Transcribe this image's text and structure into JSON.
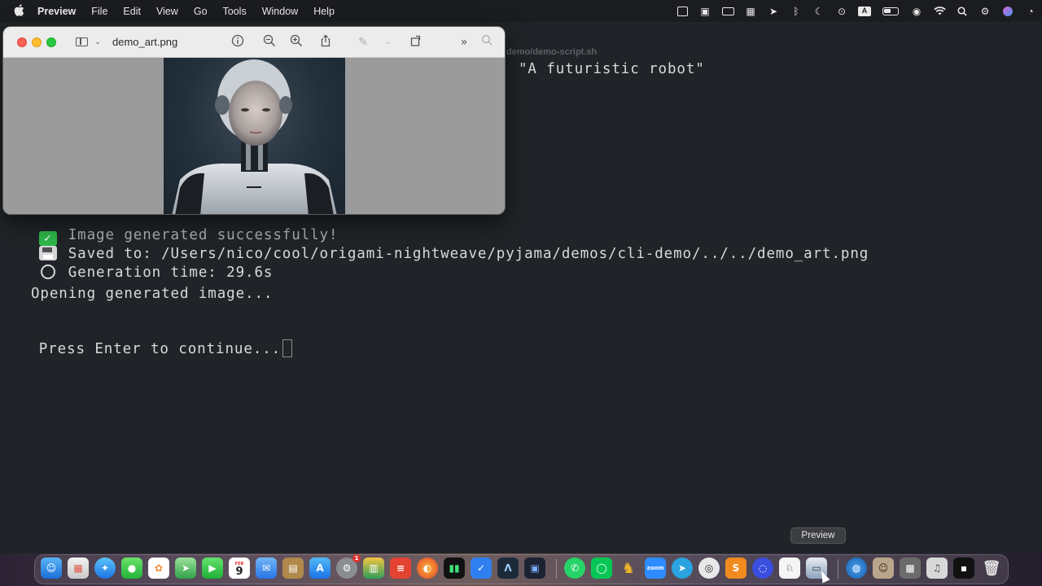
{
  "menubar": {
    "app_name": "Preview",
    "menus": [
      "File",
      "Edit",
      "View",
      "Go",
      "Tools",
      "Window",
      "Help"
    ],
    "status_icons": [
      "display-icon",
      "calendar-icon",
      "monitor-icon",
      "keyboard-icon",
      "telegram-icon",
      "bluetooth-icon",
      "moon-icon",
      "play-icon",
      "input-source-icon",
      "battery-icon",
      "user-icon",
      "wifi-icon",
      "search-icon",
      "control-center-icon",
      "siri-icon",
      "clock-icon"
    ],
    "input_source_label": "A"
  },
  "terminal": {
    "title_fragment": "demo/demo-script.sh",
    "prompt_fragment": "\"A futuristic robot\"",
    "lines": {
      "success": "Image generated successfully!",
      "saved": "Saved to: /Users/nico/cool/origami-nightweave/pyjama/demos/cli-demo/../../demo_art.png",
      "time": "Generation time: 29.6s",
      "opening": "Opening generated image...",
      "press": "Press Enter to continue..."
    }
  },
  "preview_window": {
    "filename": "demo_art.png",
    "toolbar_icons": [
      "sidebar-toggle-icon",
      "chevron-down-icon",
      "info-icon",
      "zoom-out-icon",
      "zoom-in-icon",
      "share-icon",
      "markup-icon",
      "chevron-down-icon",
      "rotate-icon",
      "more-icon",
      "search-icon"
    ]
  },
  "dock": {
    "tooltip": "Preview",
    "calendar_day": "9",
    "calendar_month": "FEB",
    "badge_count": "1",
    "zoom_label": "zoom"
  },
  "colors": {
    "terminal_bg": "#202428",
    "terminal_text": "#d8d9da",
    "menubar_bg": "#1b1c1f",
    "preview_toolbar": "#ececec",
    "success_green": "#2fb84a"
  }
}
